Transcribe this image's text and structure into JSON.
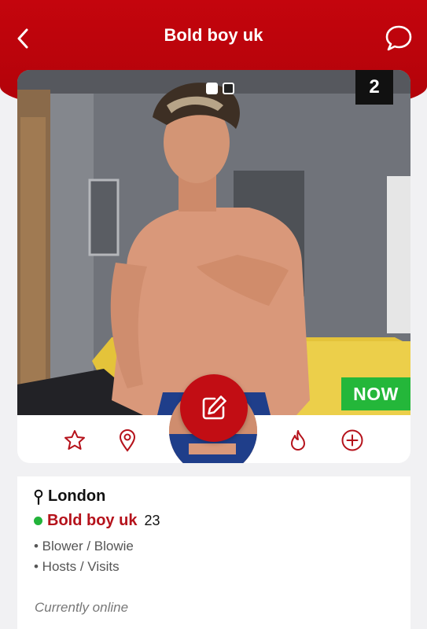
{
  "header": {
    "title": "Bold boy uk",
    "back_icon": "chevron-left-icon",
    "chat_icon": "chat-bubble-icon",
    "background": "#c4050d"
  },
  "photo": {
    "gallery_count": "2",
    "pages_total": 2,
    "current_page": 1,
    "now_badge": "NOW",
    "now_color": "#24b73a"
  },
  "actions": {
    "icons": [
      "star-icon",
      "map-pin-icon",
      "edit-icon",
      "fire-icon",
      "plus-circle-icon"
    ],
    "accent": "#b5121b"
  },
  "profile": {
    "location": "London",
    "name": "Bold boy uk",
    "age": "23",
    "tags": [
      "• Blower / Blowie",
      "• Hosts / Visits"
    ],
    "status": "Currently online",
    "online_color": "#22b33a"
  }
}
